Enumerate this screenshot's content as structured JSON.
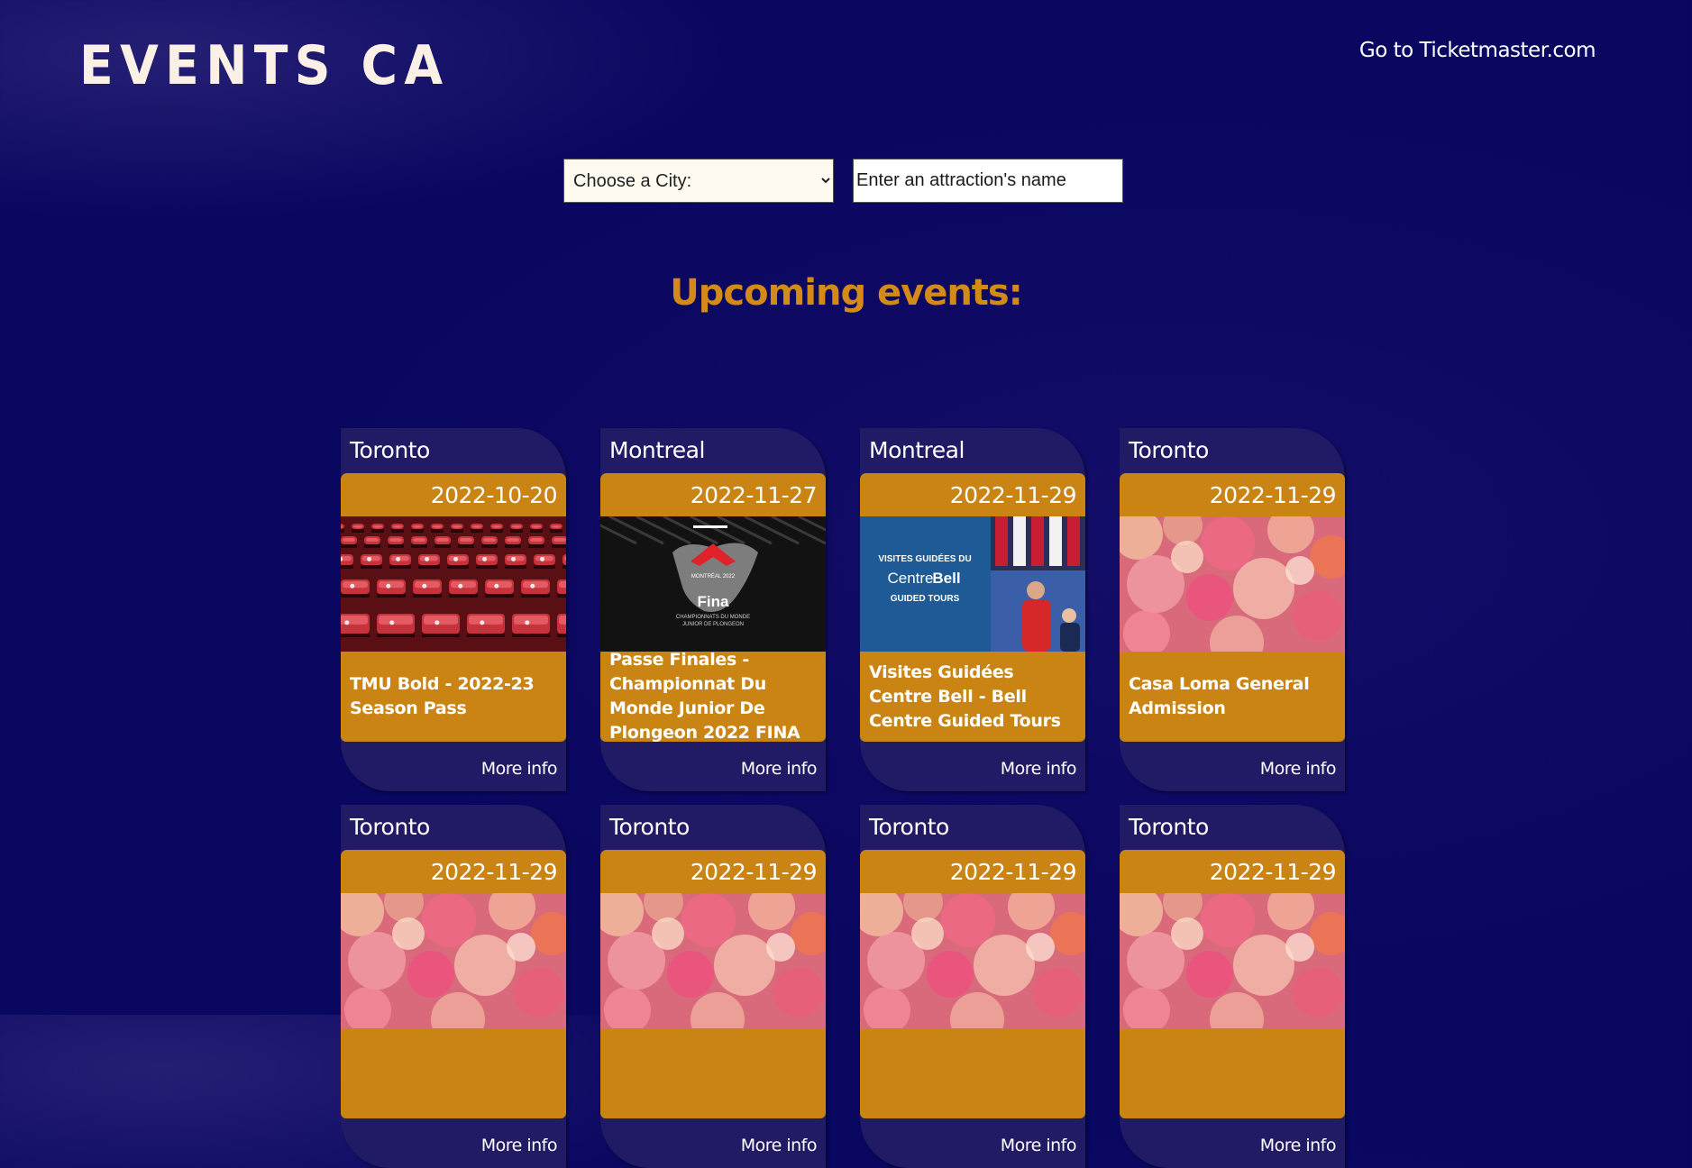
{
  "header": {
    "logo": "EVENTS CA",
    "ticketmaster_link": "Go to Ticketmaster.com"
  },
  "search": {
    "city_selected": "Choose a City:",
    "attraction_placeholder": "Enter an attraction's name"
  },
  "section_title": "Upcoming events:",
  "more_info_label": "More info",
  "events": [
    {
      "city": "Toronto",
      "date": "2022-10-20",
      "name": "TMU Bold - 2022-23 Season Pass",
      "image": "red-stadium-seats"
    },
    {
      "city": "Montreal",
      "date": "2022-11-27",
      "name": "Passe Finales - Championnat Du Monde Junior De Plongeon 2022 FINA",
      "image": "diver-fina-poster"
    },
    {
      "city": "Montreal",
      "date": "2022-11-29",
      "name": "Visites Guidées Centre Bell - Bell Centre Guided Tours",
      "image": "centre-bell-tours"
    },
    {
      "city": "Toronto",
      "date": "2022-11-29",
      "name": "Casa Loma General Admission",
      "image": "pink-bokeh"
    },
    {
      "city": "Toronto",
      "date": "2022-11-29",
      "name": "",
      "image": "pink-bokeh"
    },
    {
      "city": "Toronto",
      "date": "2022-11-29",
      "name": "",
      "image": "pink-bokeh"
    },
    {
      "city": "Toronto",
      "date": "2022-11-29",
      "name": "",
      "image": "pink-bokeh"
    },
    {
      "city": "Toronto",
      "date": "2022-11-29",
      "name": "",
      "image": "pink-bokeh"
    }
  ],
  "image_text": {
    "fina_event": "MONTRÉAL 2022",
    "fina_brand": "Fina",
    "fina_caption_1": "CHAMPIONNATS DU MONDE",
    "fina_caption_2": "JUNIOR DE PLONGEON",
    "bell_line_1": "VISITES GUIDÉES DU",
    "bell_brand_a": "Centre",
    "bell_brand_b": "Bell",
    "bell_line_2": "GUIDED TOURS"
  },
  "colors": {
    "background": "#0a0760",
    "card": "#211b65",
    "accent": "#c98414",
    "title": "#d38a16"
  }
}
